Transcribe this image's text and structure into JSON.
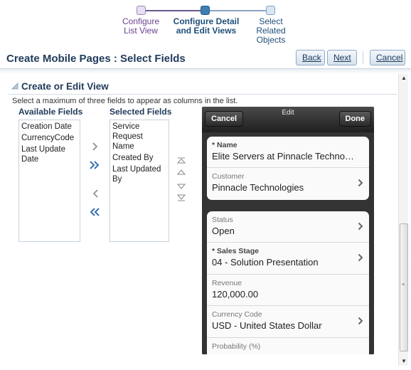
{
  "train": {
    "steps": [
      {
        "line1": "Configure",
        "line2": "List View",
        "state": "visited"
      },
      {
        "line1": "Configure Detail",
        "line2": "and Edit Views",
        "state": "current"
      },
      {
        "line1": "Select",
        "line2": "Related",
        "line3": "Objects",
        "state": "next"
      }
    ]
  },
  "header": {
    "title": "Create Mobile Pages : Select Fields",
    "back_label": "Back",
    "next_label": "Next",
    "cancel_label": "Cancel"
  },
  "section": {
    "title": "Create or Edit View",
    "instruction": "Select a maximum of three fields to appear as columns in the list."
  },
  "shuttle": {
    "available_label": "Available Fields",
    "selected_label": "Selected Fields",
    "available": [
      "Creation Date",
      "CurrencyCode",
      "Last Update Date"
    ],
    "selected": [
      "Service Request Name",
      "Created By",
      "Last Updated By"
    ]
  },
  "phone": {
    "title": "Edit",
    "cancel_label": "Cancel",
    "done_label": "Done",
    "card1": [
      {
        "label": "Name",
        "required": true,
        "value": "Elite Servers at Pinnacle Technolo..."
      },
      {
        "label": "Customer",
        "required": false,
        "value": "Pinnacle Technologies"
      }
    ],
    "card2": [
      {
        "label": "Status",
        "required": false,
        "value": "Open"
      },
      {
        "label": "Sales Stage",
        "required": true,
        "value": "04 - Solution Presentation"
      },
      {
        "label": "Revenue",
        "required": false,
        "value": "120,000.00"
      },
      {
        "label": "Currency Code",
        "required": false,
        "value": "USD - United States Dollar"
      },
      {
        "label": "Probability (%)",
        "required": false,
        "value": ""
      }
    ]
  },
  "colors": {
    "title": "#1f3a5a",
    "train_current": "#3d7fb3",
    "train_visited": "#6a3f91",
    "shuttle_icon": "#3b6fb0"
  }
}
